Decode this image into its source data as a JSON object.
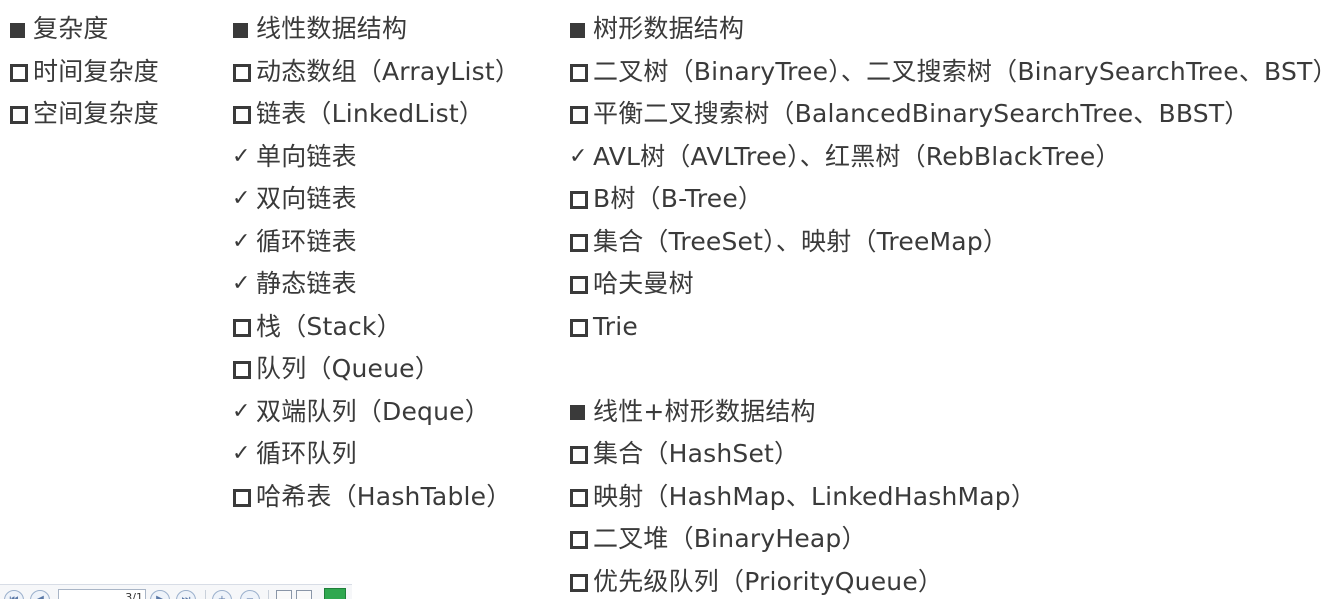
{
  "columns": [
    {
      "items": [
        {
          "type": "header",
          "text": "复杂度"
        },
        {
          "type": "box",
          "text": "时间复杂度"
        },
        {
          "type": "box",
          "text": "空间复杂度"
        }
      ]
    },
    {
      "items": [
        {
          "type": "header",
          "text": "线性数据结构"
        },
        {
          "type": "box",
          "text": "动态数组（ArrayList）"
        },
        {
          "type": "box",
          "text": "链表（LinkedList）"
        },
        {
          "type": "check",
          "text": "单向链表"
        },
        {
          "type": "check",
          "text": "双向链表"
        },
        {
          "type": "check",
          "text": "循环链表"
        },
        {
          "type": "check",
          "text": "静态链表"
        },
        {
          "type": "box",
          "text": "栈（Stack）"
        },
        {
          "type": "box",
          "text": "队列（Queue）"
        },
        {
          "type": "check",
          "text": "双端队列（Deque）"
        },
        {
          "type": "check",
          "text": "循环队列"
        },
        {
          "type": "box",
          "text": "哈希表（HashTable）"
        }
      ]
    },
    {
      "items": [
        {
          "type": "header",
          "text": "树形数据结构"
        },
        {
          "type": "box",
          "text": "二叉树（BinaryTree）、二叉搜索树（BinarySearchTree、BST）"
        },
        {
          "type": "box",
          "text": "平衡二叉搜索树（BalancedBinarySearchTree、BBST）"
        },
        {
          "type": "check",
          "text": "AVL树（AVLTree）、红黑树（RebBlackTree）"
        },
        {
          "type": "box",
          "text": "B树（B-Tree）"
        },
        {
          "type": "box",
          "text": "集合（TreeSet）、映射（TreeMap）"
        },
        {
          "type": "box",
          "text": "哈夫曼树"
        },
        {
          "type": "box",
          "text": "Trie"
        },
        {
          "type": "gap",
          "text": ""
        },
        {
          "type": "header",
          "text": "线性+树形数据结构"
        },
        {
          "type": "box",
          "text": "集合（HashSet）"
        },
        {
          "type": "box",
          "text": "映射（HashMap、LinkedHashMap）"
        },
        {
          "type": "box",
          "text": "二叉堆（BinaryHeap）"
        },
        {
          "type": "box",
          "text": "优先级队列（PriorityQueue）"
        }
      ]
    }
  ],
  "toolbar": {
    "page_value": "3/1"
  }
}
